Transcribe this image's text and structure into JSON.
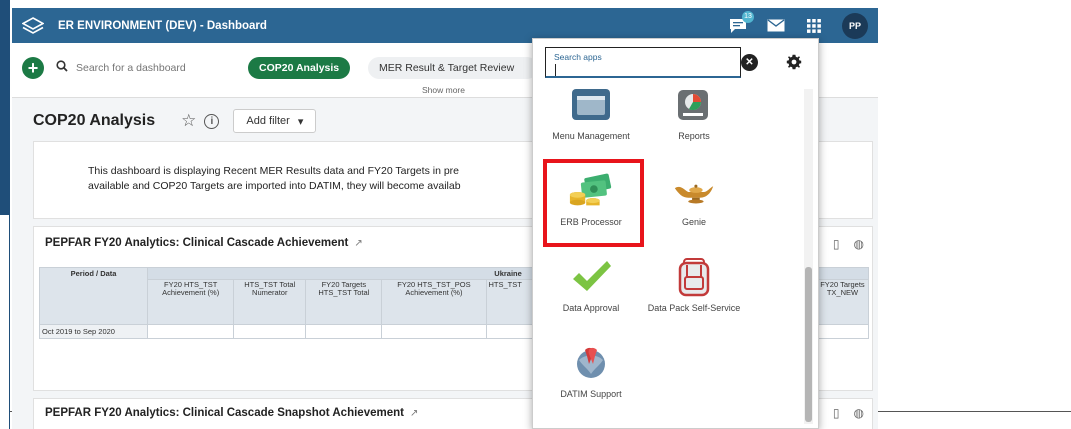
{
  "topbar": {
    "title": "ER ENVIRONMENT (DEV) - Dashboard",
    "message_count": "13",
    "avatar_initials": "PP",
    "icons": [
      "dhis2-logo-icon",
      "messages-icon",
      "mail-icon",
      "apps-grid-icon"
    ]
  },
  "dashbar": {
    "search_placeholder": "Search for a dashboard",
    "chips": [
      "COP20 Analysis",
      "MER Result & Target Review"
    ],
    "show_more": "Show more"
  },
  "dashboard": {
    "title": "COP20 Analysis",
    "add_filter": "Add filter"
  },
  "info_panel": {
    "line1": "This dashboard is displaying Recent MER Results data and FY20 Targets in pre",
    "line2": "available and COP20 Targets are imported into DATIM, they will become availab"
  },
  "item1": {
    "title": "PEPFAR FY20 Analytics: Clinical Cascade Achievement",
    "group_header": "Ukraine",
    "corner_header": "Period / Data",
    "columns": [
      "FY20 HTS_TST Achievement (%)",
      "HTS_TST Total Numerator",
      "FY20 Targets HTS_TST Total",
      "FY20 HTS_TST_POS Achievement (%)",
      "HTS_TST",
      "FY20 Targets TX_NEW"
    ],
    "row_label": "Oct 2019 to Sep 2020"
  },
  "item2": {
    "title": "PEPFAR FY20 Analytics: Clinical Cascade Snapshot Achievement"
  },
  "apps_menu": {
    "search_label": "Search apps",
    "search_value": "",
    "apps": [
      {
        "label": "Menu Management",
        "icon": "menu-management-icon"
      },
      {
        "label": "Reports",
        "icon": "reports-icon"
      },
      {
        "label": "ERB Processor",
        "icon": "erb-processor-icon"
      },
      {
        "label": "Genie",
        "icon": "genie-lamp-icon"
      },
      {
        "label": "Data Approval",
        "icon": "checkmark-icon"
      },
      {
        "label": "Data Pack Self-Service",
        "icon": "backpack-icon"
      },
      {
        "label": "DATIM Support",
        "icon": "datim-support-icon"
      }
    ],
    "highlight_color": "#e8141b"
  },
  "colors": {
    "header": "#2c6693",
    "accent_green": "#1c7a45",
    "highlight": "#e8141b"
  }
}
